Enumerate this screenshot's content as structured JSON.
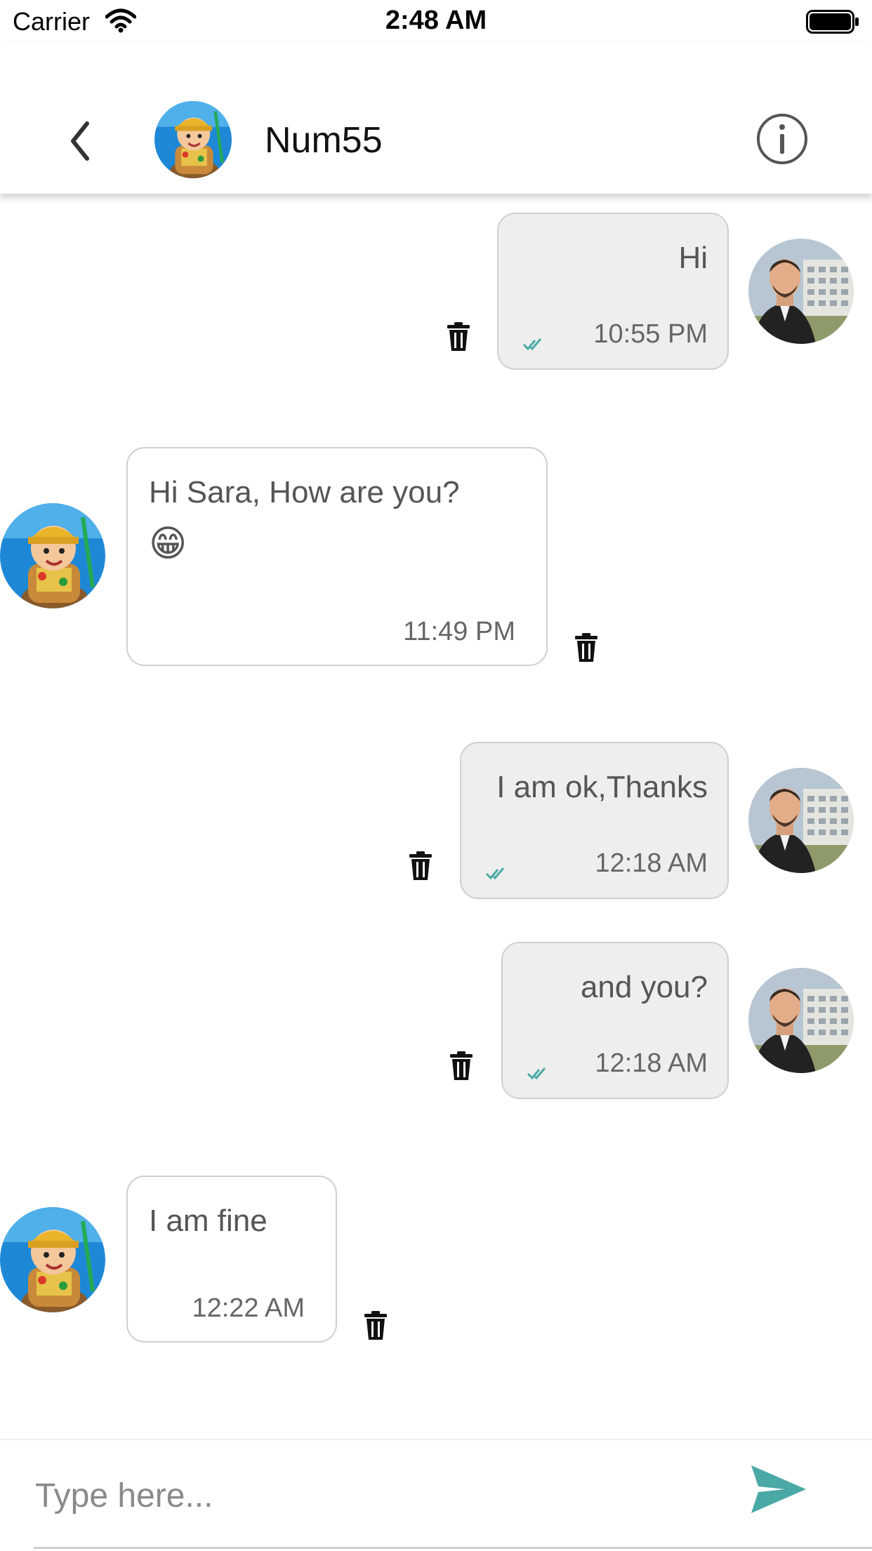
{
  "status_bar": {
    "carrier": "Carrier",
    "time": "2:48 AM"
  },
  "header": {
    "contact_name": "Num55"
  },
  "messages": [
    {
      "direction": "outgoing",
      "text": "Hi",
      "time": "10:55 PM",
      "read": true
    },
    {
      "direction": "incoming",
      "text": "Hi Sara, How are you?",
      "emoji": "😁",
      "time": "11:49 PM"
    },
    {
      "direction": "outgoing",
      "text": "I am ok,Thanks",
      "time": "12:18 AM",
      "read": true
    },
    {
      "direction": "outgoing",
      "text": "and you?",
      "time": "12:18 AM",
      "read": true
    },
    {
      "direction": "incoming",
      "text": "I am fine",
      "time": "12:22 AM"
    }
  ],
  "composer": {
    "placeholder": "Type here..."
  },
  "colors": {
    "accent": "#4aa9a5",
    "bubble_outgoing": "#eeeeee",
    "bubble_border": "#cfcfcf"
  },
  "icons": {
    "back": "chevron-left-icon",
    "info": "info-circle-icon",
    "delete": "trash-icon",
    "read_receipt": "double-check-icon",
    "send": "send-icon"
  }
}
